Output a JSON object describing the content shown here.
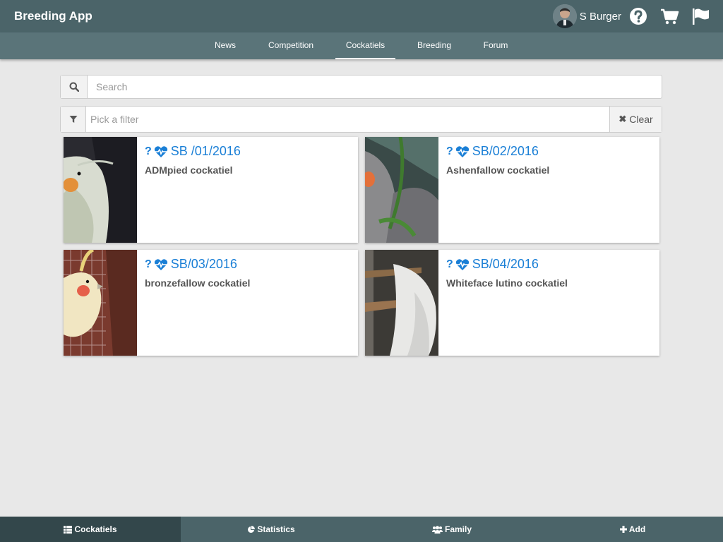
{
  "app": {
    "title": "Breeding App"
  },
  "user": {
    "name": "S Burger"
  },
  "nav": {
    "tabs": [
      {
        "label": "News"
      },
      {
        "label": "Competition"
      },
      {
        "label": "Cockatiels",
        "active": true
      },
      {
        "label": "Breeding"
      },
      {
        "label": "Forum"
      }
    ]
  },
  "search": {
    "placeholder": "Search",
    "value": ""
  },
  "filter": {
    "placeholder": "Pick a filter",
    "value": "",
    "clear_label": "Clear"
  },
  "cards": [
    {
      "id": "SB /01/2016",
      "name": "ADMpied cockatiel"
    },
    {
      "id": "SB/02/2016",
      "name": "Ashenfallow cockatiel"
    },
    {
      "id": "SB/03/2016",
      "name": "bronzefallow cockatiel"
    },
    {
      "id": "SB/04/2016",
      "name": "Whiteface lutino cockatiel"
    }
  ],
  "card_icons": {
    "question": "?",
    "heart": "heartbeat-icon"
  },
  "bottom": {
    "tabs": [
      {
        "label": "Cockatiels",
        "icon": "list-icon",
        "active": true
      },
      {
        "label": "Statistics",
        "icon": "pie-chart-icon"
      },
      {
        "label": "Family",
        "icon": "users-icon"
      },
      {
        "label": "Add",
        "icon": "plus-icon"
      }
    ]
  },
  "colors": {
    "topbar": "#4b6469",
    "navbar": "#5a7479",
    "accent": "#1a7fd6",
    "background": "#e8e8e8"
  }
}
